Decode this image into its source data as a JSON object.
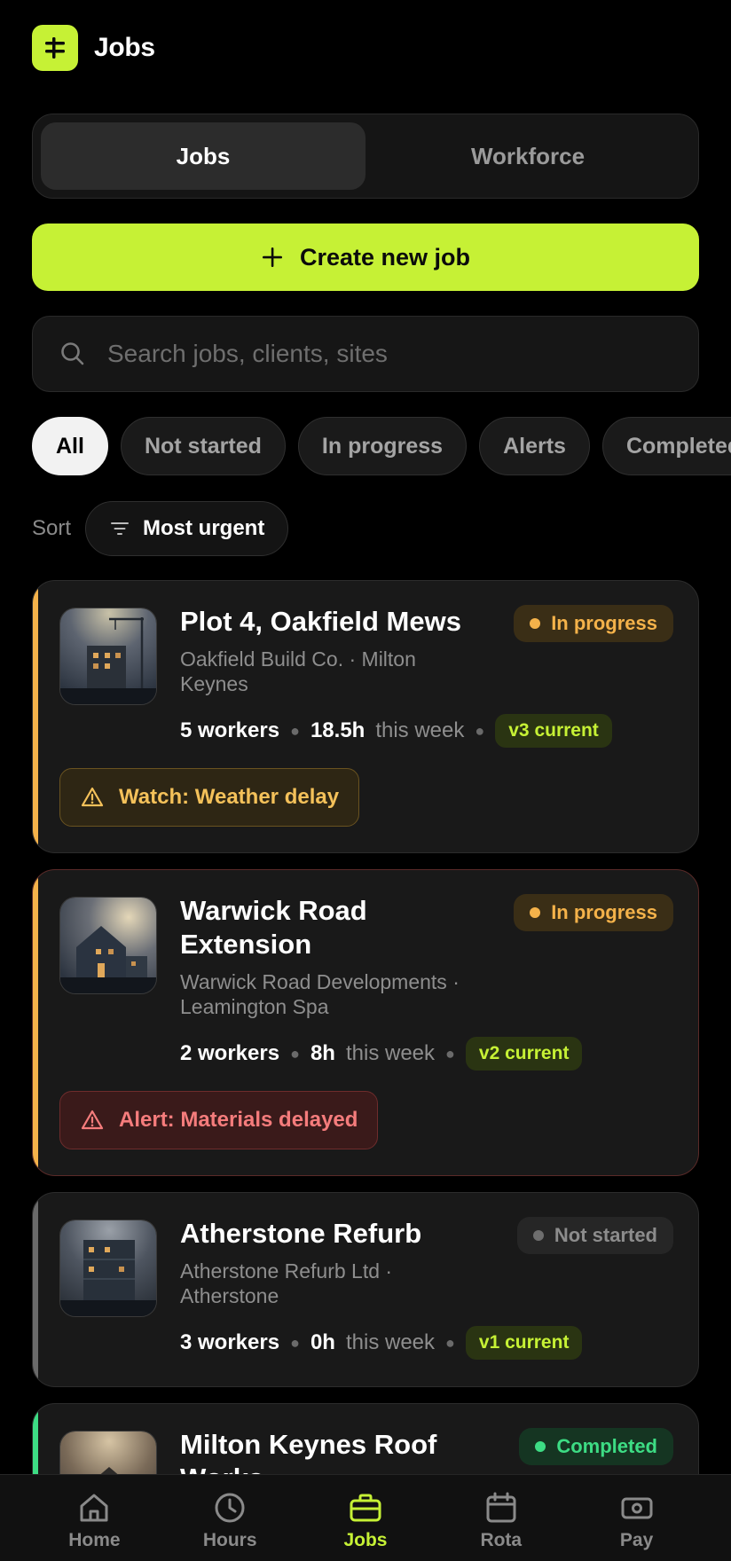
{
  "header": {
    "title": "Jobs"
  },
  "segments": [
    {
      "label": "Jobs",
      "active": true
    },
    {
      "label": "Workforce",
      "active": false
    }
  ],
  "create_button": {
    "label": "Create new job"
  },
  "search": {
    "placeholder": "Search jobs, clients, sites"
  },
  "filters": [
    "All",
    "Not started",
    "In progress",
    "Alerts",
    "Completed"
  ],
  "sort": {
    "label": "Sort",
    "value": "Most urgent"
  },
  "jobs": [
    {
      "title_line1": "Plot 4, Oakfield Mews",
      "title_line2": "",
      "client_line1": "Oakfield Build Co. · Milton",
      "client_line2": "Keynes",
      "status": "In progress",
      "workers": "5 workers",
      "hours": "18.5h",
      "hours_suffix": "this week",
      "version": "v3 current",
      "banner": "Watch: Weather delay"
    },
    {
      "title_line1": "Warwick Road",
      "title_line2": "Extension",
      "client_line1": "Warwick Road Developments ·",
      "client_line2": "Leamington Spa",
      "status": "In progress",
      "workers": "2 workers",
      "hours": "8h",
      "hours_suffix": "this week",
      "version": "v2 current",
      "banner": "Alert: Materials delayed"
    },
    {
      "title_line1": "Atherstone Refurb",
      "title_line2": "",
      "client_line1": "Atherstone Refurb Ltd ·",
      "client_line2": "Atherstone",
      "status": "Not started",
      "workers": "3 workers",
      "hours": "0h",
      "hours_suffix": "this week",
      "version": "v1 current",
      "banner": ""
    },
    {
      "title_line1": "Milton Keynes Roof",
      "title_line2": "Works",
      "status": "Completed"
    }
  ],
  "tabbar": [
    {
      "label": "Home",
      "icon": "home-icon"
    },
    {
      "label": "Hours",
      "icon": "clock-icon"
    },
    {
      "label": "Jobs",
      "icon": "briefcase-icon",
      "active": true
    },
    {
      "label": "Rota",
      "icon": "calendar-icon"
    },
    {
      "label": "Pay",
      "icon": "cash-icon"
    }
  ],
  "colors": {
    "accent": "#c6f135",
    "in_progress": "#f4b24a",
    "alert": "#f57c7c",
    "completed": "#3ddc84",
    "not_started": "#8c8c8c"
  }
}
